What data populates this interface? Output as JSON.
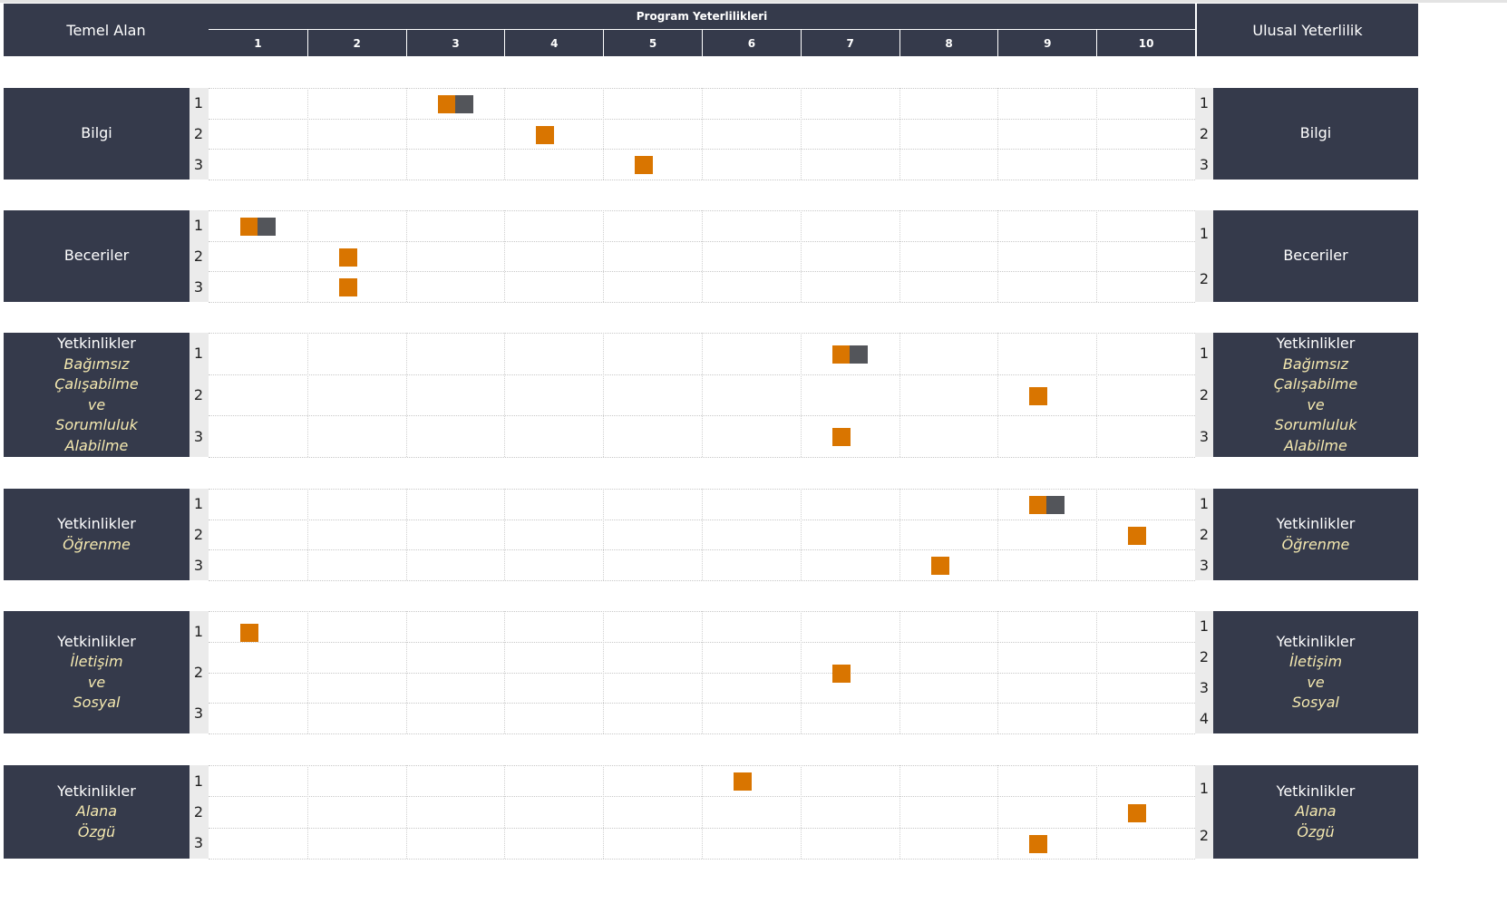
{
  "header": {
    "left_title": "Temel Alan",
    "center_title": "Program Yeterlilikleri",
    "right_title": "Ulusal Yeterlilik",
    "columns": [
      "1",
      "2",
      "3",
      "4",
      "5",
      "6",
      "7",
      "8",
      "9",
      "10"
    ]
  },
  "colors": {
    "header_bg": "#353a4b",
    "primary_mark": "#d97500",
    "secondary_mark": "#53555a",
    "subtitle_text": "#f5e9b0"
  },
  "groups": [
    {
      "title": "Bilgi",
      "subtitle": [],
      "left_rows": [
        "1",
        "2",
        "3"
      ],
      "right_rows": [
        "1",
        "2",
        "3"
      ],
      "marks": [
        {
          "row": 1,
          "col": 3,
          "secondary": true
        },
        {
          "row": 2,
          "col": 4,
          "secondary": false
        },
        {
          "row": 3,
          "col": 5,
          "secondary": false
        }
      ]
    },
    {
      "title": "Beceriler",
      "subtitle": [],
      "left_rows": [
        "1",
        "2",
        "3"
      ],
      "right_rows": [
        "1",
        "2"
      ],
      "marks": [
        {
          "row": 1,
          "col": 1,
          "secondary": true
        },
        {
          "row": 2,
          "col": 2,
          "secondary": false
        },
        {
          "row": 3,
          "col": 2,
          "secondary": false
        }
      ]
    },
    {
      "title": "Yetkinlikler",
      "subtitle": [
        "Bağımsız",
        "Çalışabilme",
        "ve",
        "Sorumluluk",
        "Alabilme"
      ],
      "left_rows": [
        "1",
        "2",
        "3"
      ],
      "right_rows": [
        "1",
        "2",
        "3"
      ],
      "marks": [
        {
          "row": 1,
          "col": 7,
          "secondary": true
        },
        {
          "row": 2,
          "col": 9,
          "secondary": false
        },
        {
          "row": 3,
          "col": 7,
          "secondary": false
        }
      ]
    },
    {
      "title": "Yetkinlikler",
      "subtitle": [
        "Öğrenme"
      ],
      "left_rows": [
        "1",
        "2",
        "3"
      ],
      "right_rows": [
        "1",
        "2",
        "3"
      ],
      "marks": [
        {
          "row": 1,
          "col": 9,
          "secondary": true
        },
        {
          "row": 2,
          "col": 10,
          "secondary": false
        },
        {
          "row": 3,
          "col": 8,
          "secondary": false
        }
      ]
    },
    {
      "title": "Yetkinlikler",
      "subtitle": [
        "İletişim",
        "ve",
        "Sosyal"
      ],
      "left_rows": [
        "1",
        "2",
        "3"
      ],
      "right_rows": [
        "1",
        "2",
        "3",
        "4"
      ],
      "marks": [
        {
          "row": 1,
          "col": 1,
          "secondary": false
        },
        {
          "row": 2,
          "col": 7,
          "secondary": false
        }
      ]
    },
    {
      "title": "Yetkinlikler",
      "subtitle": [
        "Alana",
        "Özgü"
      ],
      "left_rows": [
        "1",
        "2",
        "3"
      ],
      "right_rows": [
        "1",
        "2"
      ],
      "marks": [
        {
          "row": 1,
          "col": 6,
          "secondary": false
        },
        {
          "row": 2,
          "col": 10,
          "secondary": false
        },
        {
          "row": 3,
          "col": 9,
          "secondary": false
        }
      ]
    }
  ]
}
